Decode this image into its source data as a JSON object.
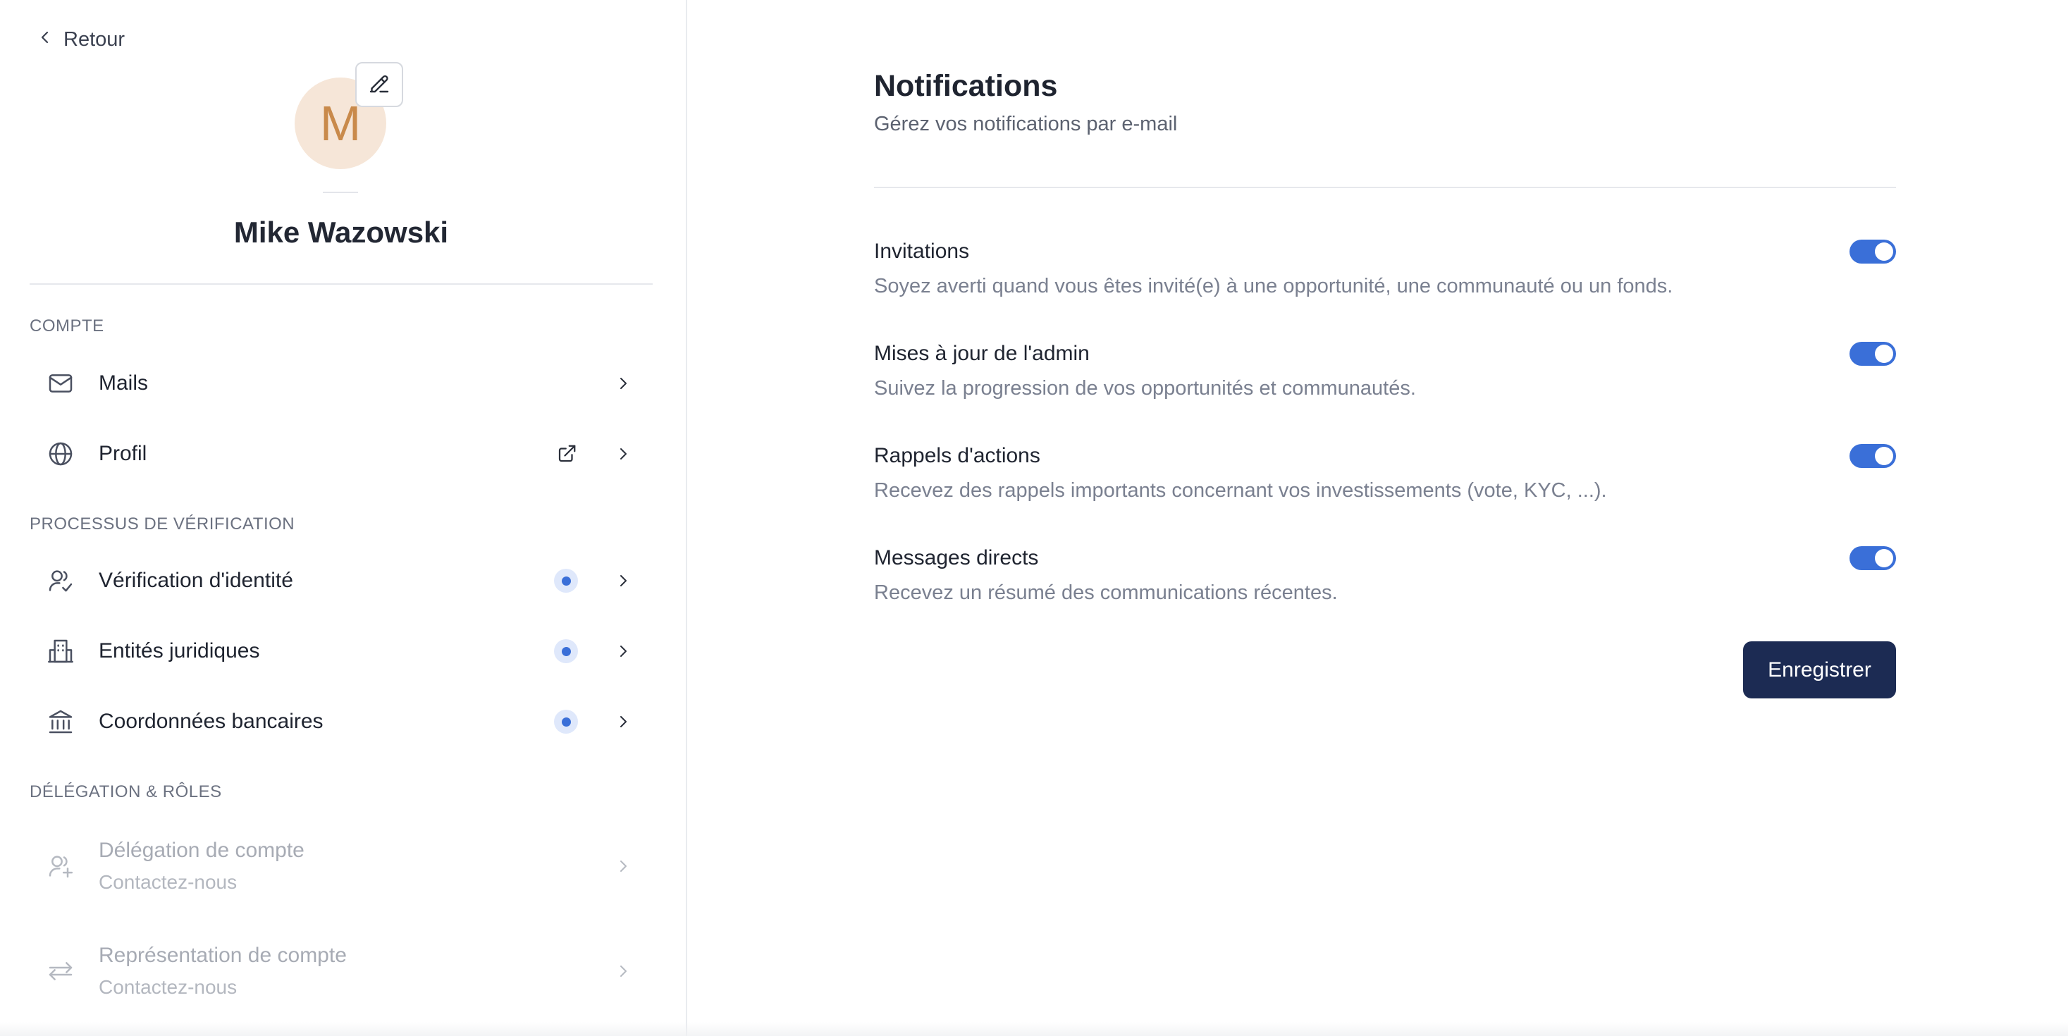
{
  "back": {
    "label": "Retour"
  },
  "user": {
    "initial": "M",
    "name": "Mike Wazowski"
  },
  "sidebar": {
    "sections": [
      {
        "title": "COMPTE"
      },
      {
        "title": "PROCESSUS DE VÉRIFICATION"
      },
      {
        "title": "DÉLÉGATION & RÔLES"
      }
    ],
    "items": [
      {
        "label": "Mails",
        "icon": "mail-icon"
      },
      {
        "label": "Profil",
        "icon": "globe-icon"
      },
      {
        "label": "Vérification d'identité",
        "icon": "user-check-icon",
        "pending": true
      },
      {
        "label": "Entités juridiques",
        "icon": "building-icon",
        "pending": true
      },
      {
        "label": "Coordonnées bancaires",
        "icon": "bank-icon",
        "pending": true
      },
      {
        "label": "Délégation de compte",
        "sub": "Contactez-nous",
        "icon": "user-plus-icon",
        "disabled": true
      },
      {
        "label": "Représentation de compte",
        "sub": "Contactez-nous",
        "icon": "swap-arrows-icon",
        "disabled": true
      }
    ]
  },
  "main": {
    "title": "Notifications",
    "subtitle": "Gérez vos notifications par e-mail",
    "notifications": [
      {
        "title": "Invitations",
        "description": "Soyez averti quand vous êtes invité(e) à une opportunité, une communauté ou un fonds.",
        "enabled": true
      },
      {
        "title": "Mises à jour de l'admin",
        "description": "Suivez la progression de vos opportunités et communautés.",
        "enabled": true
      },
      {
        "title": "Rappels d'actions",
        "description": "Recevez des rappels importants concernant vos investissements (vote, KYC, ...).",
        "enabled": true
      },
      {
        "title": "Messages directs",
        "description": "Recevez un résumé des communications récentes.",
        "enabled": true
      }
    ],
    "save_label": "Enregistrer"
  },
  "colors": {
    "accent": "#3a6fd8",
    "primary_button": "#1c2b53",
    "avatar_bg": "#f6e6d8",
    "avatar_fg": "#c98a4b"
  }
}
